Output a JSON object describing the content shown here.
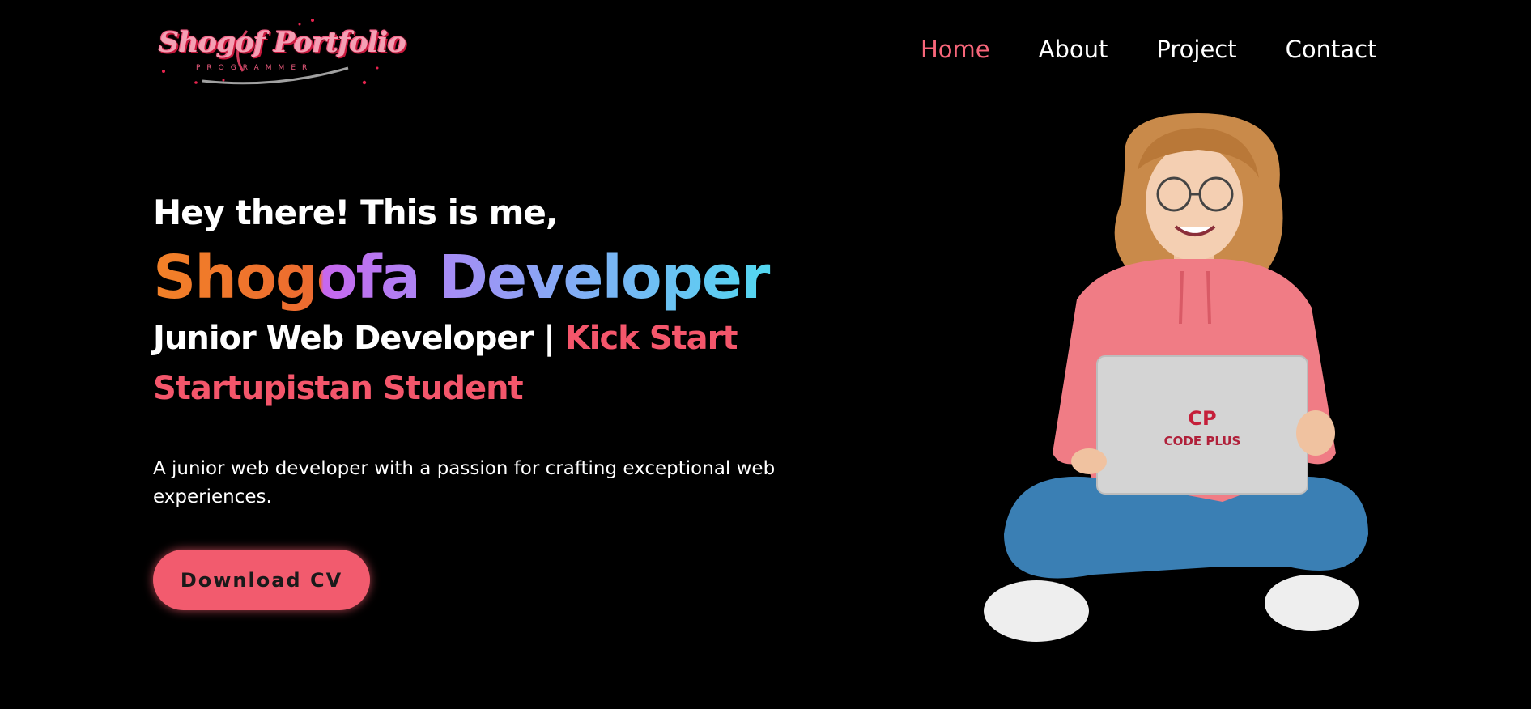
{
  "header": {
    "logo": {
      "title": "Shogof Portfolio",
      "subtitle": "PROGRAMMER"
    },
    "nav": [
      {
        "label": "Home",
        "active": true
      },
      {
        "label": "About",
        "active": false
      },
      {
        "label": "Project",
        "active": false
      },
      {
        "label": "Contact",
        "active": false
      }
    ]
  },
  "hero": {
    "greeting": "Hey there! This is me,",
    "name": "Shogofa Developer",
    "role_prefix": "Junior Web Developer | ",
    "role_highlight": "Kick Start",
    "role_line2": "Startupistan Student",
    "description": "A junior web developer with a passion for crafting exceptional web experiences.",
    "cta_label": "Download CV",
    "laptop_logo_mark": "CP",
    "laptop_logo_text": "CODE PLUS"
  },
  "colors": {
    "background": "#000000",
    "accent": "#f4566b",
    "nav_active": "#f7667a",
    "button": "#f25b6e"
  }
}
